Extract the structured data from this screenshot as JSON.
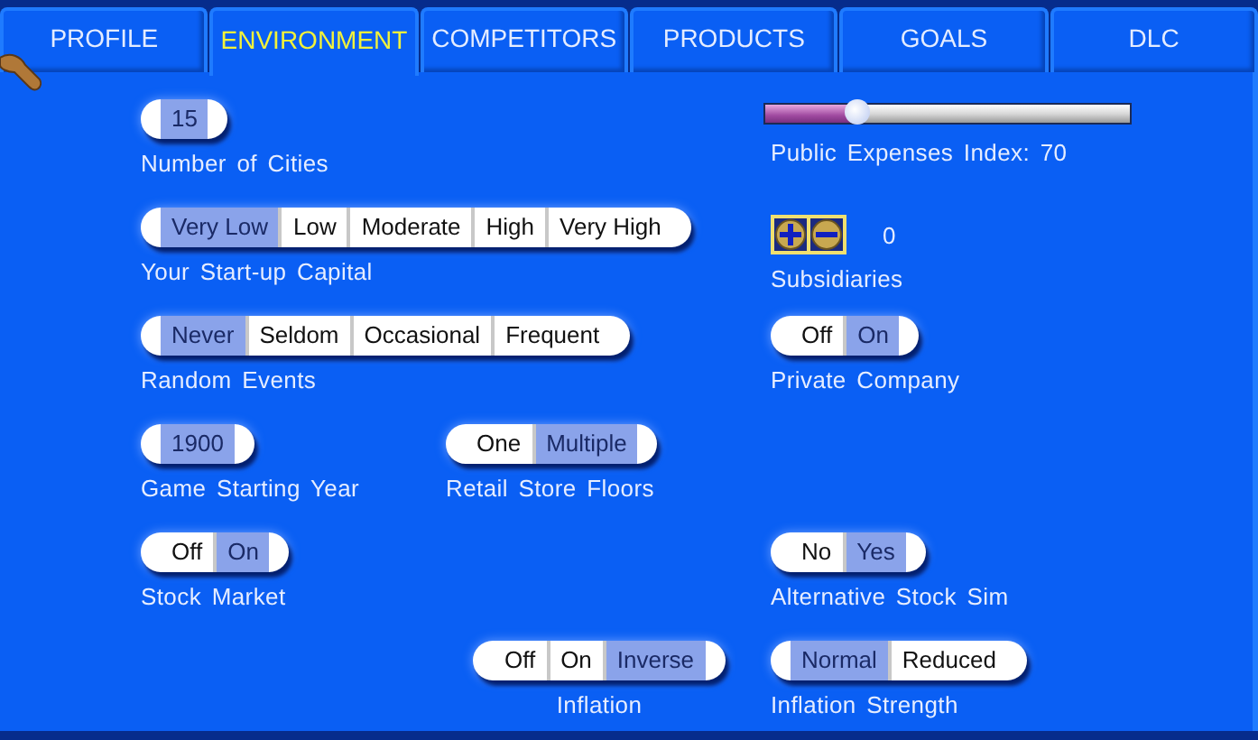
{
  "tabs": [
    {
      "label": "PROFILE",
      "selected": false
    },
    {
      "label": "ENVIRONMENT",
      "selected": true
    },
    {
      "label": "COMPETITORS",
      "selected": false
    },
    {
      "label": "PRODUCTS",
      "selected": false
    },
    {
      "label": "GOALS",
      "selected": false
    },
    {
      "label": "DLC",
      "selected": false
    }
  ],
  "rows": [
    {
      "left": {
        "kind": "segmented",
        "label": "Number of Cities",
        "options": [
          {
            "label": "15",
            "selected": true
          }
        ]
      },
      "right": {
        "kind": "slider",
        "label": "Public Expenses Index:  70",
        "level": 0.25
      }
    },
    {
      "left": {
        "kind": "segmented",
        "label": "Your Start-up Capital",
        "options": [
          {
            "label": "Very Low",
            "selected": true
          },
          {
            "label": "Low",
            "selected": false
          },
          {
            "label": "Moderate",
            "selected": false
          },
          {
            "label": "High",
            "selected": false
          },
          {
            "label": "Very High",
            "selected": false
          }
        ]
      },
      "right": {
        "kind": "stepper",
        "label": "Subsidiaries",
        "value": "0"
      }
    },
    {
      "left": {
        "kind": "segmented",
        "label": "Random Events",
        "options": [
          {
            "label": "Never",
            "selected": true
          },
          {
            "label": "Seldom",
            "selected": false
          },
          {
            "label": "Occasional",
            "selected": false
          },
          {
            "label": "Frequent",
            "selected": false
          }
        ]
      },
      "right": {
        "kind": "segmented",
        "label": "Private Company",
        "options": [
          {
            "label": "Off",
            "selected": false
          },
          {
            "label": "On",
            "selected": true
          }
        ]
      }
    },
    {
      "left": {
        "kind": "segmented",
        "label": "Game Starting Year",
        "options": [
          {
            "label": "1900",
            "selected": true
          }
        ]
      },
      "middle": {
        "kind": "segmented",
        "label": "Retail Store Floors",
        "options": [
          {
            "label": "One",
            "selected": false
          },
          {
            "label": "Multiple",
            "selected": true
          }
        ]
      }
    },
    {
      "left": {
        "kind": "segmented",
        "label": "Stock Market",
        "options": [
          {
            "label": "Off",
            "selected": false
          },
          {
            "label": "On",
            "selected": true
          }
        ]
      },
      "right": {
        "kind": "segmented",
        "label": "Alternative Stock Sim",
        "options": [
          {
            "label": "No",
            "selected": false
          },
          {
            "label": "Yes",
            "selected": true
          }
        ]
      }
    },
    {
      "middle": {
        "kind": "segmented",
        "label": "Inflation",
        "options": [
          {
            "label": "Off",
            "selected": false
          },
          {
            "label": "On",
            "selected": false
          },
          {
            "label": "Inverse",
            "selected": true
          }
        ]
      },
      "right": {
        "kind": "segmented",
        "label": "Inflation Strength",
        "options": [
          {
            "label": "Normal",
            "selected": true
          },
          {
            "label": "Reduced",
            "selected": false
          }
        ]
      }
    }
  ]
}
